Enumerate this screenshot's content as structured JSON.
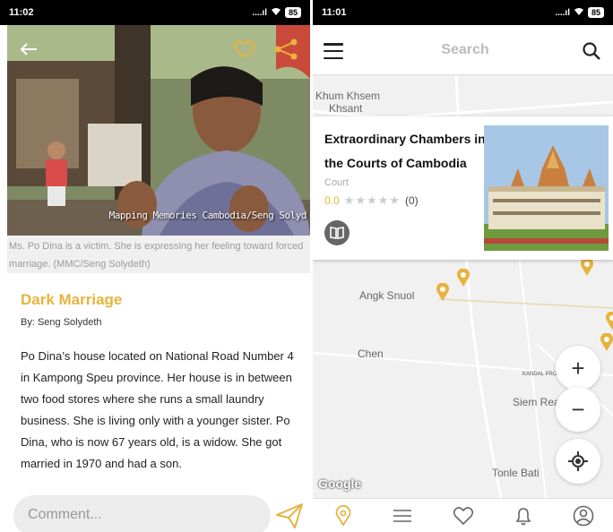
{
  "left": {
    "status": {
      "time": "11:02",
      "signal": "....ıl",
      "battery": "85"
    },
    "hero": {
      "overlay_caption": "Mapping Memories Cambodia/Seng Solyd"
    },
    "photo_caption": "Ms. Po Dina is a victim. She is expressing her feeling toward forced marriage. (MMC/Seng Solydeth)",
    "article": {
      "title": "Dark Marriage",
      "byline": "By: Seng Solydeth",
      "body": "Po Dina’s house located on National Road Number 4 in Kampong Speu province. Her house is in between two food stores where she runs a small laundry business. She is living only with a younger sister. Po Dina, who is now 67 years old, is a widow. She got married in 1970 and had a son."
    },
    "comment": {
      "placeholder": "Comment..."
    }
  },
  "right": {
    "status": {
      "time": "11:01",
      "signal": "....ıl",
      "battery": "85"
    },
    "search": {
      "placeholder": "Search"
    },
    "map_labels": [
      "Khum Khsem",
      "Khsant",
      "Angk Snuol",
      "Chen",
      "Siem Rea",
      "Tonle Bati",
      "KANDAL PRO"
    ],
    "card": {
      "title": "Extraordinary Chambers in the Courts of Cambodia",
      "category": "Court",
      "rating": "0.0",
      "stars": "★★★★★",
      "review_count": "(0)"
    },
    "zoom": {
      "in": "+",
      "out": "−"
    },
    "google": "Google",
    "nav_icons": [
      "map-pin-icon",
      "list-icon",
      "heart-icon",
      "bell-icon",
      "user-icon"
    ],
    "accent": "#e8b33c"
  }
}
